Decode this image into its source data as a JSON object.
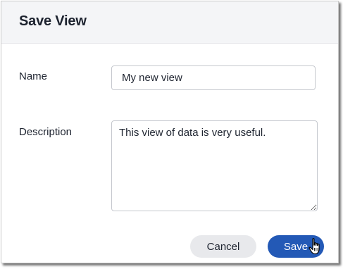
{
  "dialog": {
    "title": "Save View",
    "name_label": "Name",
    "name_value": "My new view",
    "description_label": "Description",
    "description_value": "This view of data is very useful.",
    "cancel_label": "Cancel",
    "save_label": "Save"
  },
  "colors": {
    "header_bg": "#f4f5f7",
    "primary": "#2359b6",
    "secondary_bg": "#e8e9ec",
    "text": "#1d232f"
  },
  "icons": {
    "cursor": "hand-pointer-icon"
  }
}
